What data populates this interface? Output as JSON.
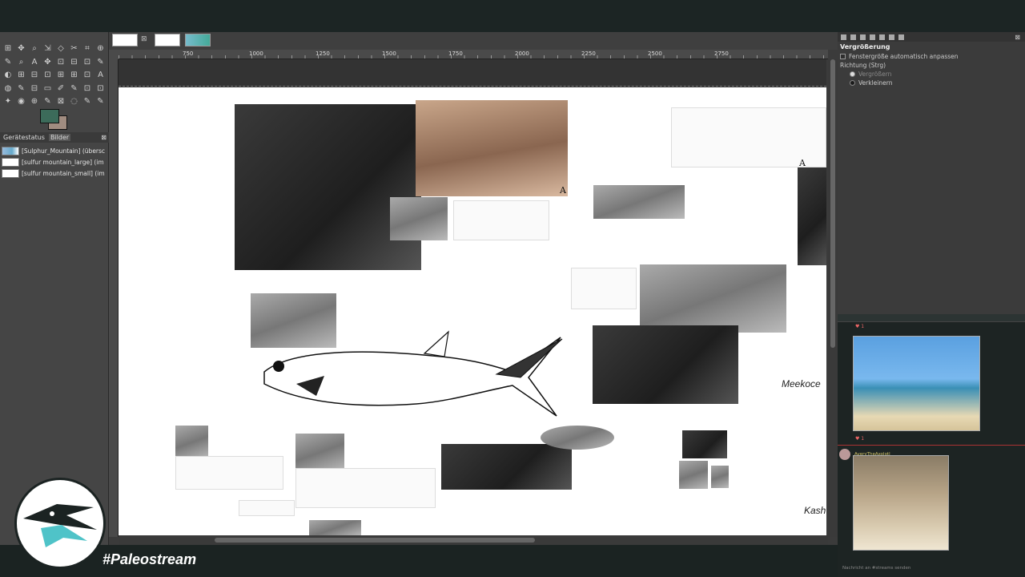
{
  "toolbox": {
    "tools": [
      "⊞",
      "✥",
      "⌕",
      "⇲",
      "◇",
      "✂",
      "⌗",
      "⊕",
      "✎",
      "⌕",
      "A",
      "✥",
      "⊡",
      "⊟",
      "⊡",
      "✎",
      "◐",
      "⊞",
      "⊟",
      "⊡",
      "⊞",
      "⊞",
      "⊡",
      "A",
      "◍",
      "✎",
      "⊟",
      "▭",
      "✐",
      "✎",
      "⊡",
      "⊡",
      "✦",
      "◉",
      "⊕",
      "✎",
      "⊠",
      "◌",
      "✎",
      "✎"
    ],
    "fg_color": "#3c6b5a",
    "bg_color": "#a08c80"
  },
  "left_dock": {
    "tabs": [
      "Gerätestatus",
      "Bilder"
    ],
    "close": "⊠",
    "images": [
      "[Sulphur_Mountain] (übersc",
      "[sulfur mountain_large] (im",
      "[sulfur mountain_small] (im"
    ]
  },
  "canvas": {
    "tab_close": "⊠",
    "ruler_ticks": [
      "750",
      "1000",
      "1250",
      "1500",
      "1750",
      "2000",
      "2250",
      "2500",
      "2750"
    ],
    "labels": [
      "A",
      "A"
    ],
    "side_texts": [
      "Meekoce",
      "Kash"
    ]
  },
  "right_dock": {
    "title": "Vergrößerung",
    "option_resize": "Fenstergröße automatisch anpassen",
    "direction_label": "Richtung (Strg)",
    "option_zoom_in": "Vergrößern",
    "option_zoom_out": "Verkleinern",
    "close": "⊠"
  },
  "chat": {
    "reaction_1": "♥ 1",
    "reaction_2": "♥ 1",
    "user": "AveryTheAxolotl",
    "input_placeholder": "Nachricht an #streams senden"
  },
  "overlay": {
    "hashtag": "#Paleostream"
  }
}
